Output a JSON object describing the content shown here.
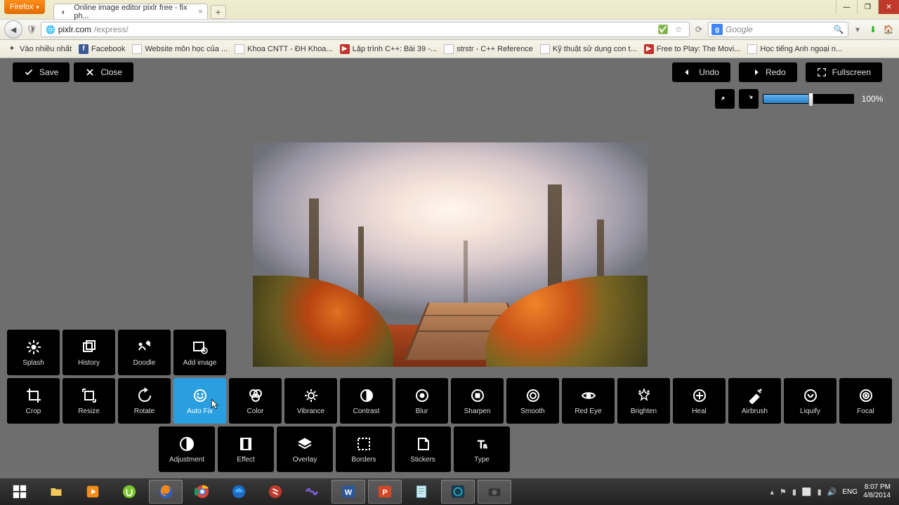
{
  "browser": {
    "name": "Firefox",
    "tab_title": "Online image editor pixlr free - fix ph...",
    "url_domain": "pixlr.com",
    "url_path": "/express/",
    "search_engine_badge": "g",
    "search_placeholder": "Google"
  },
  "window_controls": {
    "minimize": "—",
    "maximize": "❐",
    "close": "✕"
  },
  "bookmarks": [
    {
      "label": "Vào nhiều nhất",
      "kind": "star"
    },
    {
      "label": "Facebook",
      "kind": "fb"
    },
    {
      "label": "Website môn học của ...",
      "kind": "page"
    },
    {
      "label": "Khoa CNTT - ĐH Khoa...",
      "kind": "page"
    },
    {
      "label": "Lập trình C++: Bài 39 -...",
      "kind": "yt"
    },
    {
      "label": "strstr - C++ Reference",
      "kind": "page"
    },
    {
      "label": "Kỹ thuật sử dụng con t...",
      "kind": "page"
    },
    {
      "label": "Free to Play: The Movi...",
      "kind": "yt"
    },
    {
      "label": "Học tiếng Anh ngoại n...",
      "kind": "page"
    }
  ],
  "toolbar": {
    "save": "Save",
    "close": "Close",
    "undo": "Undo",
    "redo": "Redo",
    "fullscreen": "Fullscreen"
  },
  "zoom": {
    "percent_label": "100%",
    "percent_value": 50
  },
  "tools_row1": [
    {
      "id": "splash",
      "label": "Splash"
    },
    {
      "id": "history",
      "label": "History"
    },
    {
      "id": "doodle",
      "label": "Doodle"
    },
    {
      "id": "add-image",
      "label": "Add image"
    }
  ],
  "tools_row2": [
    {
      "id": "crop",
      "label": "Crop"
    },
    {
      "id": "resize",
      "label": "Resize"
    },
    {
      "id": "rotate",
      "label": "Rotate"
    },
    {
      "id": "auto-fix",
      "label": "Auto Fix",
      "selected": true
    },
    {
      "id": "color",
      "label": "Color"
    },
    {
      "id": "vibrance",
      "label": "Vibrance"
    },
    {
      "id": "contrast",
      "label": "Contrast"
    },
    {
      "id": "blur",
      "label": "Blur"
    },
    {
      "id": "sharpen",
      "label": "Sharpen"
    },
    {
      "id": "smooth",
      "label": "Smooth"
    },
    {
      "id": "red-eye",
      "label": "Red Eye"
    },
    {
      "id": "brighten",
      "label": "Brighten"
    },
    {
      "id": "heal",
      "label": "Heal"
    },
    {
      "id": "airbrush",
      "label": "Airbrush"
    },
    {
      "id": "liquify",
      "label": "Liquify"
    },
    {
      "id": "focal",
      "label": "Focal"
    }
  ],
  "tools_row3": [
    {
      "id": "adjustment",
      "label": "Adjustment"
    },
    {
      "id": "effect",
      "label": "Effect"
    },
    {
      "id": "overlay",
      "label": "Overlay"
    },
    {
      "id": "borders",
      "label": "Borders"
    },
    {
      "id": "stickers",
      "label": "Stickers"
    },
    {
      "id": "type",
      "label": "Type"
    }
  ],
  "taskbar": {
    "lang": "ENG",
    "time": "8:07 PM",
    "date": "4/8/2014"
  }
}
